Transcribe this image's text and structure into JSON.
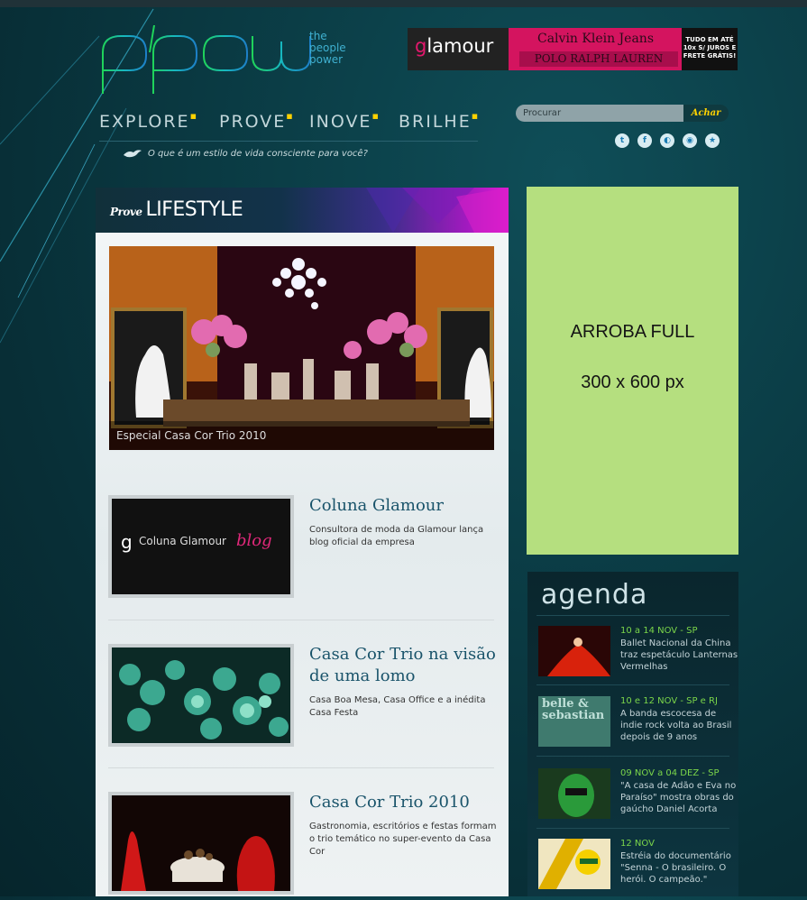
{
  "logo": {
    "tag_lines": [
      "the",
      "people",
      "power"
    ]
  },
  "banner": {
    "brand_g": "g",
    "brand_rest": "lamour",
    "calvin_klein": "Calvin Klein Jeans",
    "polo": "POLO RALPH LAUREN",
    "promo_lines": [
      "TUDO EM ATÉ",
      "10x S/ JUROS E",
      "FRETE GRÁTIS!"
    ]
  },
  "nav": {
    "items": [
      {
        "label": "EXPLORE"
      },
      {
        "label": "PROVE"
      },
      {
        "label": "INOVE"
      },
      {
        "label": "BRILHE"
      }
    ]
  },
  "tagline": "O que é um estilo de vida consciente para você?",
  "search": {
    "placeholder": "Procurar",
    "button": "Achar"
  },
  "social": {
    "icons": [
      "twitter-icon",
      "facebook-icon",
      "globe-icon",
      "rss-icon",
      "star-icon"
    ]
  },
  "main": {
    "section_prefix": "Prove",
    "section_title": "LIFESTYLE",
    "featured_caption": "Especial Casa Cor Trio 2010",
    "articles": [
      {
        "title": "Coluna Glamour",
        "desc": "Consultora de moda da Glamour lança blog oficial da empresa",
        "thumb_text_1": "g",
        "thumb_text_2": "Coluna Glamour",
        "thumb_text_3": "blog"
      },
      {
        "title": "Casa Cor Trio na visão de uma lomo",
        "desc": "Casa Boa Mesa, Casa Office e a inédita Casa Festa"
      },
      {
        "title": "Casa Cor Trio 2010",
        "desc": "Gastronomia, escritórios e festas formam o trio temático no super-evento da Casa Cor"
      }
    ]
  },
  "ad": {
    "line1": "ARROBA FULL",
    "line2": "300 x 600 px"
  },
  "agenda": {
    "title": "agenda",
    "items": [
      {
        "date": "10 a 14 NOV - SP",
        "text": "Ballet Nacional da China traz espetáculo Lanternas Vermelhas"
      },
      {
        "date": "10 e 12 NOV - SP e RJ",
        "text": "A banda escocesa de indie rock volta ao Brasil depois de 9 anos",
        "thumb_text": "belle & sebastian"
      },
      {
        "date": "09 NOV a 04 DEZ - SP",
        "text": "\"A casa de Adão e Eva no Paraíso\" mostra obras do gaúcho Daniel Acorta"
      },
      {
        "date": "12 NOV",
        "text": "Estréia do documentário \"Senna - O brasileiro. O herói. O campeão.\""
      }
    ]
  },
  "colors": {
    "accent_green": "#7bd64a",
    "nav_dot": "#ffd200",
    "ad_bg": "#b5df7f",
    "title_blue": "#19536a"
  }
}
